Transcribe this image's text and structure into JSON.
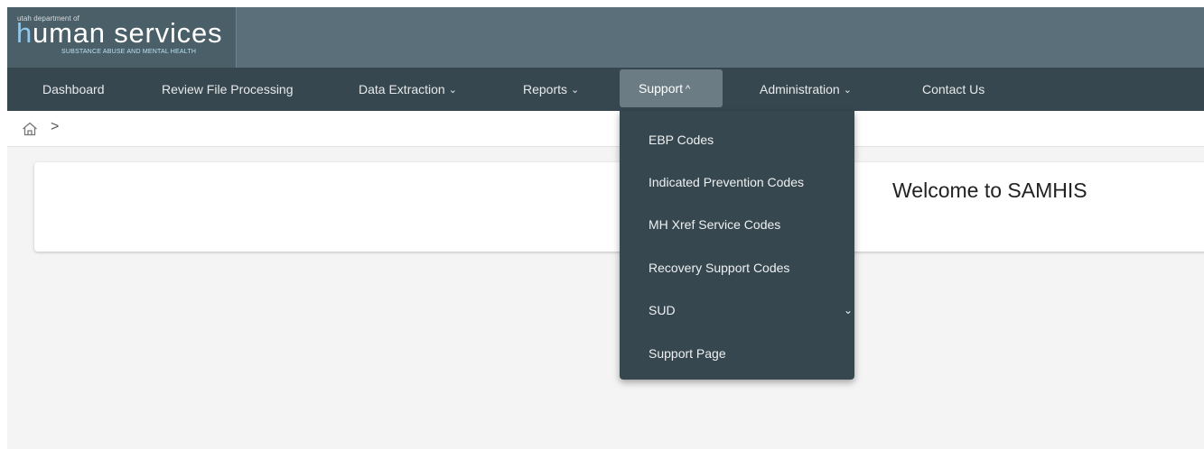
{
  "logo": {
    "top_text": "utah department of",
    "main_text_h": "h",
    "main_text_rest": "uman services",
    "sub_text": "SUBSTANCE ABUSE AND MENTAL HEALTH"
  },
  "nav": {
    "items": [
      {
        "label": "Dashboard"
      },
      {
        "label": "Review File Processing"
      },
      {
        "label": "Data Extraction"
      },
      {
        "label": "Reports"
      },
      {
        "label": "Support"
      },
      {
        "label": "Administration"
      },
      {
        "label": "Contact Us"
      }
    ],
    "chevron_down": "⌄",
    "chevron_up": "^"
  },
  "breadcrumb": {
    "home_icon": "home-icon",
    "separator": ">"
  },
  "main": {
    "welcome": "Welcome to SAMHIS"
  },
  "support_menu": {
    "items": [
      {
        "label": "EBP Codes"
      },
      {
        "label": "Indicated Prevention Codes"
      },
      {
        "label": "MH Xref Service Codes"
      },
      {
        "label": "Recovery Support Codes"
      },
      {
        "label": "SUD"
      },
      {
        "label": "Support Page"
      }
    ],
    "sud_chevron": "⌄"
  },
  "colors": {
    "topbar": "#5a6f79",
    "navbar": "#37474f",
    "nav_active": "#6b7c85",
    "dropdown": "#37474f",
    "page_bg": "#f4f4f4"
  }
}
